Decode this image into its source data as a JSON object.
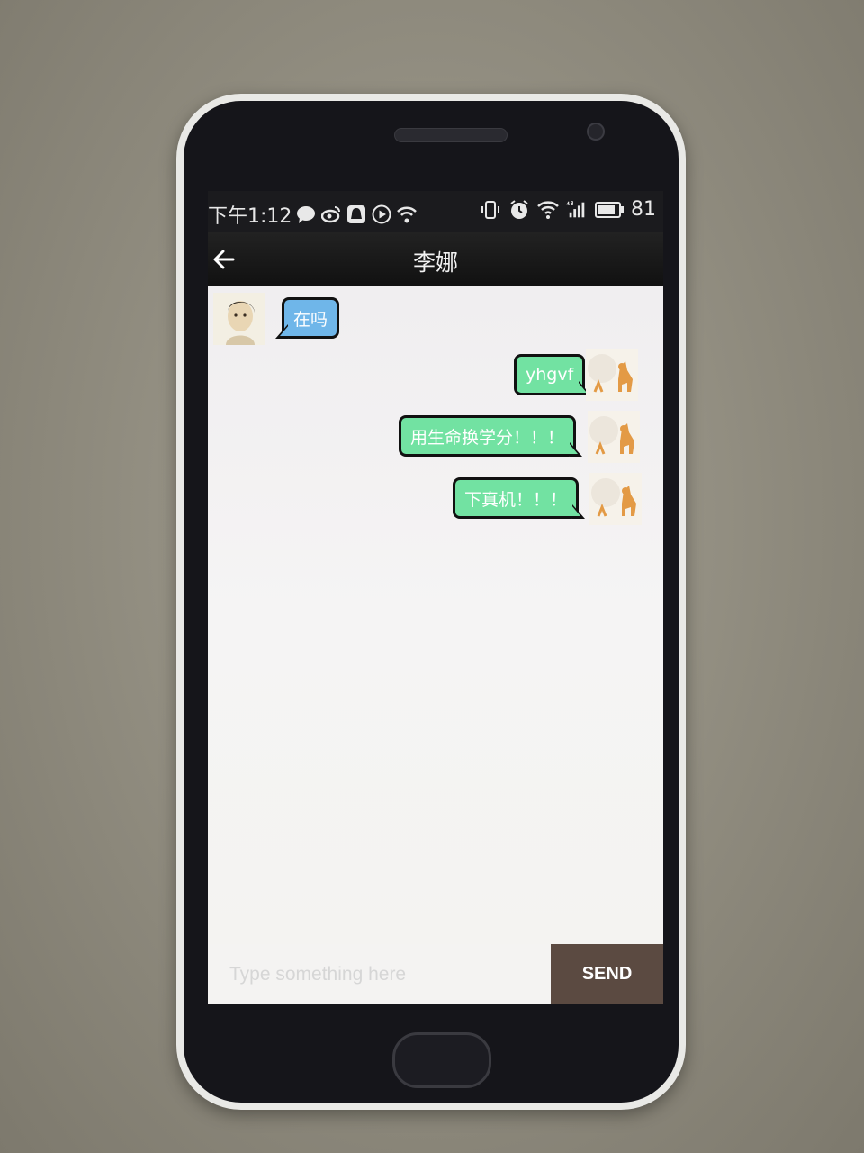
{
  "status_bar": {
    "time": "下午1:12",
    "battery": "81"
  },
  "header": {
    "title": "李娜"
  },
  "messages": [
    {
      "direction": "incoming",
      "text": "在吗"
    },
    {
      "direction": "outgoing",
      "text": "yhgvf"
    },
    {
      "direction": "outgoing",
      "text": "用生命换学分！！！"
    },
    {
      "direction": "outgoing",
      "text": "下真机！！！"
    }
  ],
  "composer": {
    "placeholder": "Type something here",
    "send_label": "SEND"
  },
  "colors": {
    "incoming_bubble": "#6fb6e9",
    "outgoing_bubble": "#72e2a2",
    "send_button": "#5b4a41",
    "title_bar": "#1a1a1a"
  }
}
